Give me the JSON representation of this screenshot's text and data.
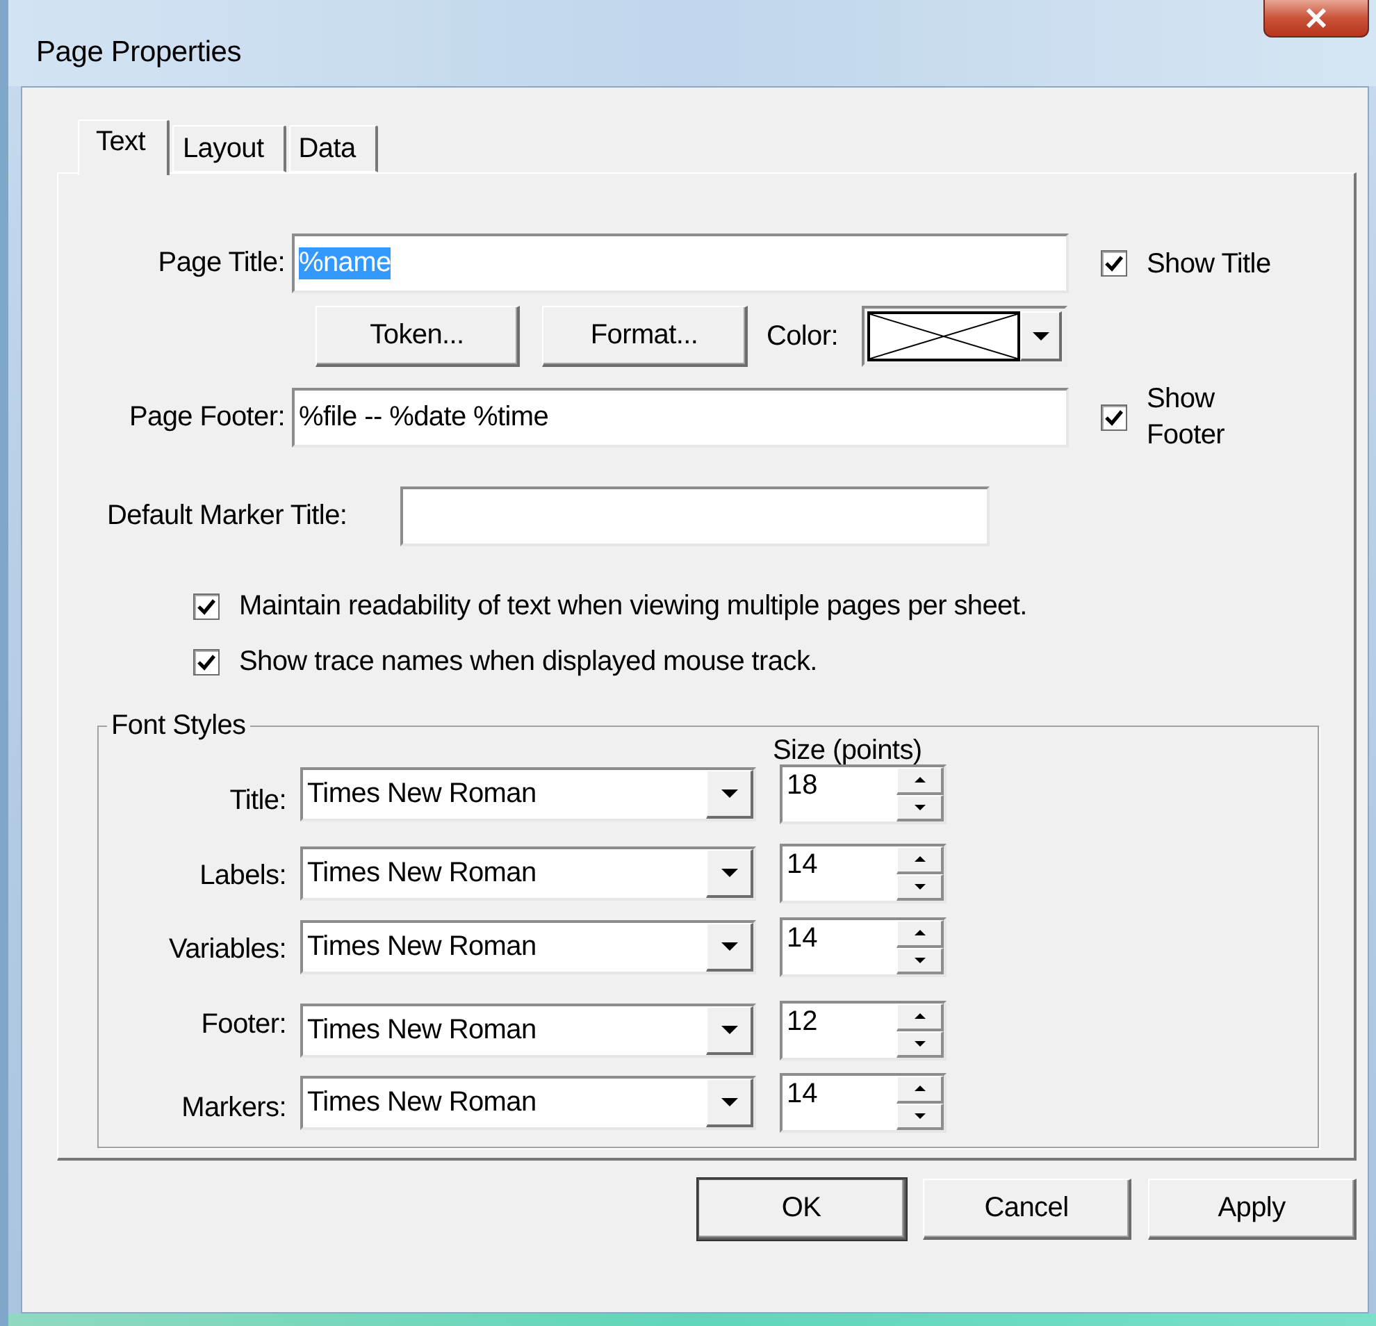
{
  "window": {
    "title": "Page Properties"
  },
  "tabs": [
    {
      "label": "Text",
      "selected": true
    },
    {
      "label": "Layout",
      "selected": false
    },
    {
      "label": "Data",
      "selected": false
    }
  ],
  "page_title": {
    "label": "Page Title:",
    "value": "%name",
    "highlighted": true
  },
  "show_title": {
    "label": "Show Title",
    "checked": true
  },
  "token_button": {
    "label": "Token..."
  },
  "format_button": {
    "label": "Format..."
  },
  "color": {
    "label": "Color:"
  },
  "page_footer": {
    "label": "Page Footer:",
    "value": "%file -- %date %time",
    "highlighted": false
  },
  "show_footer": {
    "label": "Show Footer",
    "checked": true
  },
  "default_marker_title": {
    "label": "Default Marker Title:"
  },
  "options": [
    {
      "label": "Maintain readability of text when viewing multiple pages per sheet.",
      "checked": true
    },
    {
      "label": "Show trace names when displayed mouse track.",
      "checked": true
    }
  ],
  "font_styles": {
    "title": "Font Styles",
    "size_header": "Size (points)",
    "rows": [
      {
        "label": "Title:",
        "font": "Times New Roman",
        "size": "18"
      },
      {
        "label": "Labels:",
        "font": "Times New Roman",
        "size": "14"
      },
      {
        "label": "Variables:",
        "font": "Times New Roman",
        "size": "14"
      },
      {
        "label": "Footer:",
        "font": "Times New Roman",
        "size": "12"
      },
      {
        "label": "Markers:",
        "font": "Times New Roman",
        "size": "14"
      }
    ]
  },
  "buttons": [
    {
      "label": "OK",
      "default": true
    },
    {
      "label": "Cancel",
      "default": false
    },
    {
      "label": "Apply",
      "default": false
    }
  ]
}
